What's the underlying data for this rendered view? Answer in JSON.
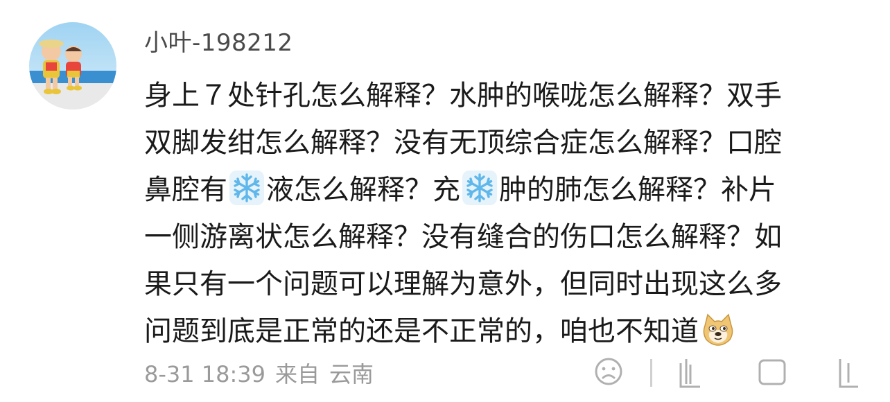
{
  "comment": {
    "username": "小叶-198212",
    "lines": [
      [
        {
          "t": "身上７处针孔怎么解释？水肿的喉咙怎么解释？双手"
        }
      ],
      [
        {
          "t": "双脚发绀怎么解释？没有无顶综合症怎么解释？口腔"
        }
      ],
      [
        {
          "t": "鼻腔有"
        },
        {
          "emoji": "snowflake-icon"
        },
        {
          "t": "液怎么解释？充"
        },
        {
          "emoji": "snowflake-icon"
        },
        {
          "t": "肿的肺怎么解释？补片"
        }
      ],
      [
        {
          "t": "一侧游离状怎么解释？没有缝合的伤口怎么解释？如"
        }
      ],
      [
        {
          "t": "果只有一个问题可以理解为意外，但同时出现这么多"
        }
      ],
      [
        {
          "t": "问题到底是正常的还是不正常的，咱也不知道"
        },
        {
          "emoji": "doge-icon"
        }
      ]
    ],
    "timestamp": "8-31 18:39",
    "source_prefix": "来自",
    "location": "云南"
  },
  "colors": {
    "text": "#1a1a1a",
    "username": "#4a4a4a",
    "meta": "#9a9a9a",
    "icon": "#b0b0b0"
  },
  "icons": [
    "avatar",
    "snowflake-icon",
    "doge-icon",
    "sad-face-icon",
    "repost-icon",
    "comment-icon",
    "like-icon"
  ]
}
